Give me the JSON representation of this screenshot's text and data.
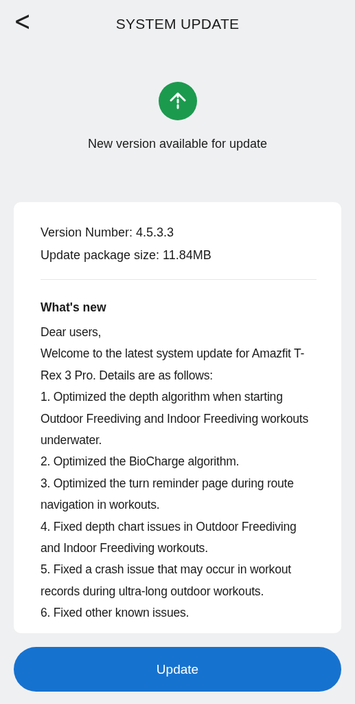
{
  "header": {
    "back": "<",
    "title": "SYSTEM UPDATE"
  },
  "status": {
    "message": "New version available for update"
  },
  "info": {
    "version": "Version Number: 4.5.3.3",
    "size": "Update package size: 11.84MB"
  },
  "whats_new": {
    "heading": "What's new",
    "paragraphs": [
      "Dear users,",
      "Welcome to the latest system update for Amazfit T-Rex 3 Pro. Details are as follows:",
      "1. Optimized the depth algorithm when starting Outdoor Freediving and Indoor Freediving workouts underwater.",
      "2. Optimized the BioCharge algorithm.",
      "3. Optimized the turn reminder page during route navigation in workouts.",
      "4. Fixed depth chart issues in Outdoor Freediving and Indoor Freediving workouts.",
      "5. Fixed a crash issue that may occur in workout records during ultra-long outdoor workouts.",
      "6. Fixed other known issues."
    ]
  },
  "button": "Update"
}
